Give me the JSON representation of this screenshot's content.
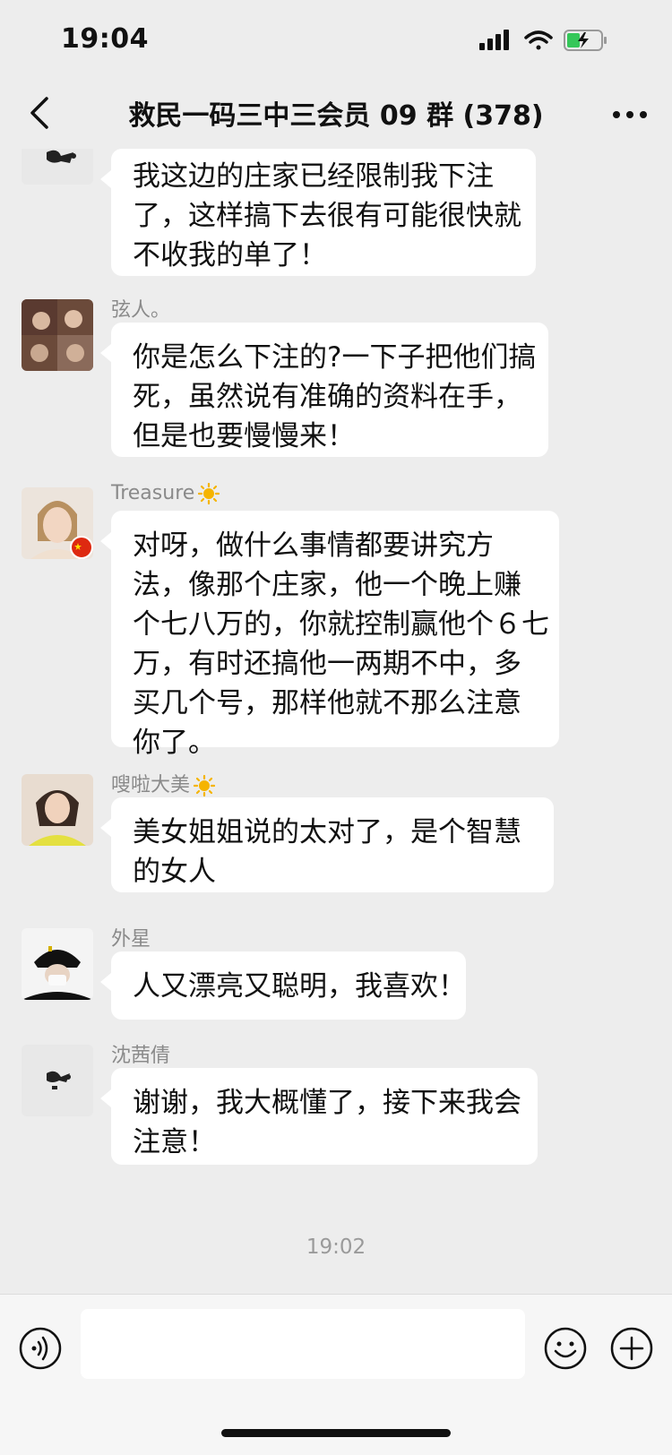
{
  "status": {
    "time": "19:04"
  },
  "header": {
    "title": "救民一码三中三会员 09 群 (378)"
  },
  "messages": [
    {
      "sender": "",
      "lines": [
        "我这边的庄家已经限制我下注",
        "了，这样搞下去很有可能很快就",
        "不收我的单了！"
      ]
    },
    {
      "sender": "弦人。",
      "lines": [
        "你是怎么下注的?一下子把他们搞",
        "死，虽然说有准确的资料在手，",
        "但是也要慢慢来！"
      ]
    },
    {
      "sender": "Treasure",
      "lines": [
        "对呀，做什么事情都要讲究方",
        "法，像那个庄家，他一个晚上赚",
        "个七八万的，你就控制赢他个６七",
        "万，有时还搞他一两期不中，多",
        "买几个号，那样他就不那么注意",
        "你了。"
      ]
    },
    {
      "sender": "嗖啦大美",
      "lines": [
        "美女姐姐说的太对了，是个智慧",
        "的女人"
      ]
    },
    {
      "sender": "外星",
      "lines": [
        "人又漂亮又聪明，我喜欢！"
      ]
    },
    {
      "sender": "沈茜倩",
      "lines": [
        "谢谢，我大概懂了，接下来我会",
        "注意！"
      ]
    }
  ],
  "timestamp": "19:02",
  "input": {
    "value": "",
    "placeholder": ""
  },
  "colors": {
    "background": "#ededed",
    "bubble": "#ffffff",
    "sun": "#f5b400"
  }
}
